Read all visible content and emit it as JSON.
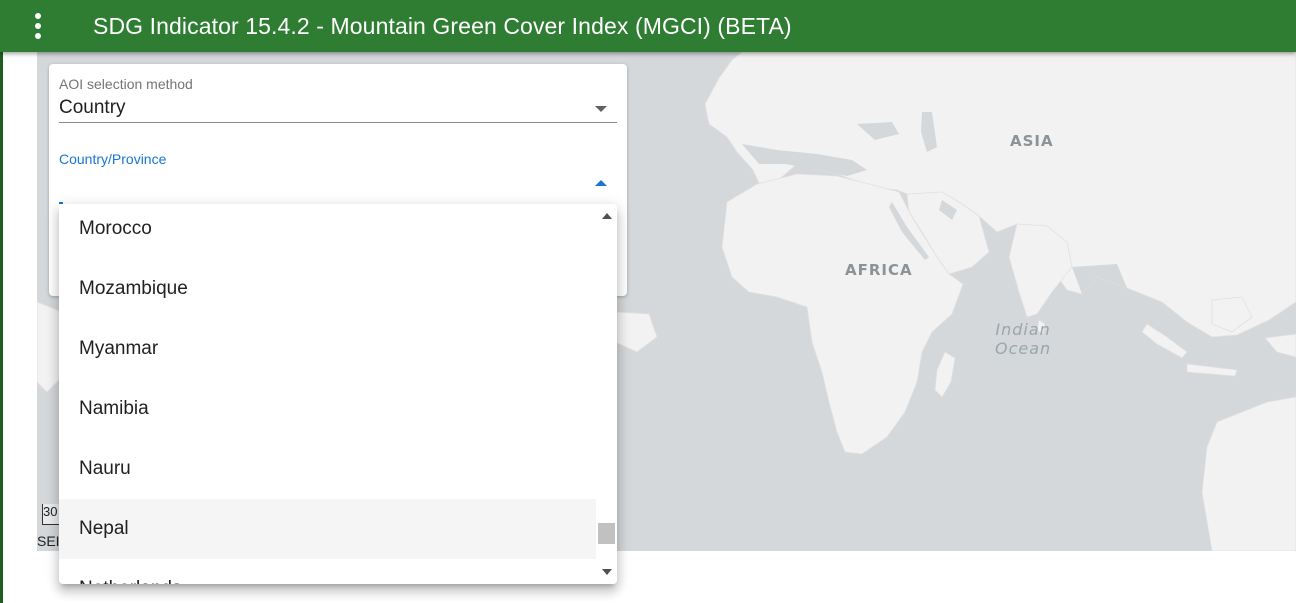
{
  "app_bar": {
    "title": "SDG Indicator 15.4.2 - Mountain Green Cover Index (MGCI) (BETA)",
    "menu_icon": "more-vert-icon",
    "color": "#2e7d32"
  },
  "map": {
    "labels": {
      "asia": "ASIA",
      "africa": "AFRICA",
      "ocean_line1": "Indian",
      "ocean_line2": "Ocean"
    },
    "scale_text": "30",
    "footer_text": "SEI"
  },
  "aoi_panel": {
    "method_label": "AOI selection method",
    "method_value": "Country",
    "country_label": "Country/Province"
  },
  "dropdown": {
    "items": [
      {
        "label": "Morocco"
      },
      {
        "label": "Mozambique"
      },
      {
        "label": "Myanmar"
      },
      {
        "label": "Namibia"
      },
      {
        "label": "Nauru"
      },
      {
        "label": "Nepal",
        "selected": true
      },
      {
        "label": "Netherlands"
      }
    ]
  },
  "colors": {
    "accent": "#1976d2",
    "map_water": "#d4d8da",
    "map_land": "#f2f2f2",
    "selected_item": "#f5f5f5"
  }
}
